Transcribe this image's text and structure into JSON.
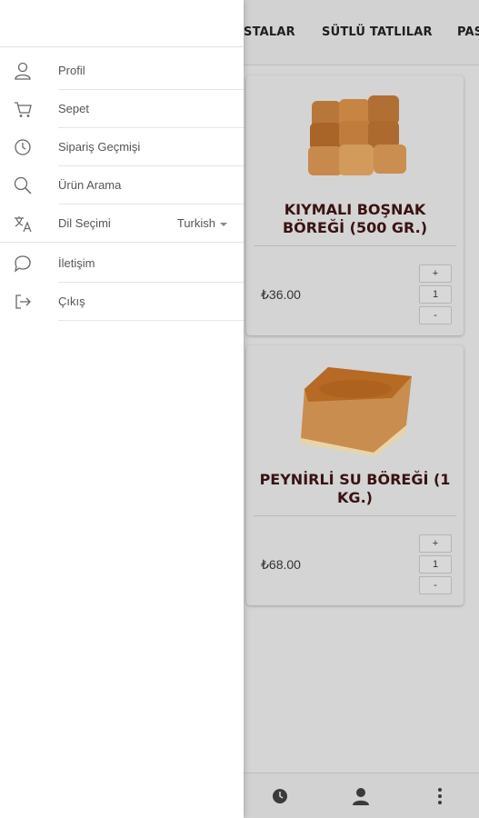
{
  "categories": [
    "STALAR",
    "SÜTLÜ TATLILAR",
    "PAS"
  ],
  "products": [
    {
      "name": "KIYMALI BOŞNAK BÖREĞİ (500 GR.)",
      "price": "₺36.00",
      "qty": "1",
      "plus": "+",
      "minus": "-",
      "image": "kiymali-bosnak-boregi-photo"
    },
    {
      "name": "PEYNİRLİ SU BÖREĞİ (1 KG.)",
      "price": "₺68.00",
      "qty": "1",
      "plus": "+",
      "minus": "-",
      "image": "peynirli-su-boregi-photo"
    }
  ],
  "menu": {
    "profile": "Profil",
    "cart": "Sepet",
    "order_history": "Sipariş Geçmişi",
    "product_search": "Ürün Arama",
    "language": "Dil Seçimi",
    "language_value": "Turkish",
    "contact": "İletişim",
    "logout": "Çıkış"
  },
  "icons": {
    "profile": "person-icon",
    "cart": "cart-icon",
    "order_history": "clock-icon",
    "product_search": "search-icon",
    "language": "translate-icon",
    "contact": "chat-icon",
    "logout": "logout-icon",
    "bottom": [
      "clock-icon",
      "person-icon",
      "more-vertical-icon"
    ]
  },
  "colors": {
    "product_title": "#3a1212",
    "overlay": "#d5d5d5",
    "drawer": "#ffffff"
  }
}
